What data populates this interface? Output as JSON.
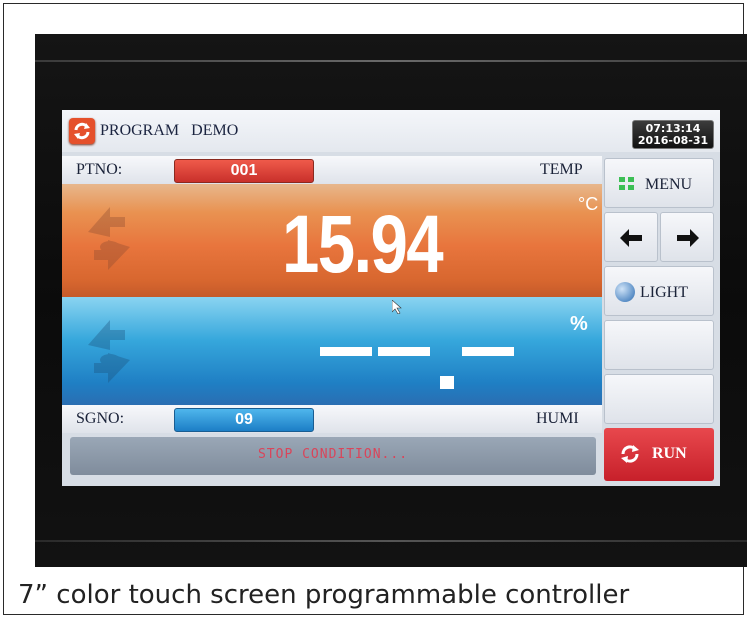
{
  "header": {
    "title": "PROGRAM   DEMO",
    "time": "07:13:14",
    "date": "2016-08-31"
  },
  "temperature": {
    "ptno_label": "PTNO:",
    "ptno_value": "001",
    "section_label": "TEMP",
    "value": "15.94",
    "unit": "°C"
  },
  "humidity": {
    "sgno_label": "SGNO:",
    "sgno_value": "09",
    "section_label": "HUMI",
    "unit": "%"
  },
  "side_menu": {
    "menu_label": "MENU",
    "light_label": "LIGHT",
    "run_label": "RUN"
  },
  "status": {
    "text": "STOP CONDITION..."
  },
  "caption": "7” color touch screen programmable controller",
  "colors": {
    "temp_accent": "#e8753d",
    "humi_accent": "#1f7fc4",
    "run_red": "#d6303a",
    "menu_green": "#3cbf55",
    "status_text": "#d9455a"
  }
}
